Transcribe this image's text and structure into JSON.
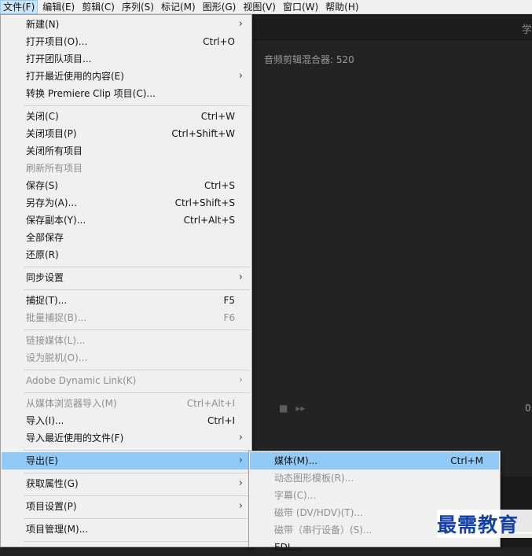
{
  "menubar": {
    "items": [
      "文件(F)",
      "编辑(E)",
      "剪辑(C)",
      "序列(S)",
      "标记(M)",
      "图形(G)",
      "视图(V)",
      "窗口(W)",
      "帮助(H)"
    ]
  },
  "background": {
    "panel_tab_fragment": "学",
    "audio_mixer_title": "音频剪辑混合器: 520",
    "timecode_fragment": "0"
  },
  "file_menu": {
    "new": {
      "label": "新建(N)"
    },
    "open_project": {
      "label": "打开项目(O)...",
      "shortcut": "Ctrl+O"
    },
    "open_team_project": {
      "label": "打开团队项目..."
    },
    "open_recent": {
      "label": "打开最近使用的内容(E)"
    },
    "convert_clip": {
      "label": "转换 Premiere Clip 项目(C)..."
    },
    "close": {
      "label": "关闭(C)",
      "shortcut": "Ctrl+W"
    },
    "close_project": {
      "label": "关闭项目(P)",
      "shortcut": "Ctrl+Shift+W"
    },
    "close_all_projects": {
      "label": "关闭所有项目"
    },
    "refresh_all_projects": {
      "label": "刷新所有项目"
    },
    "save": {
      "label": "保存(S)",
      "shortcut": "Ctrl+S"
    },
    "save_as": {
      "label": "另存为(A)...",
      "shortcut": "Ctrl+Shift+S"
    },
    "save_copy": {
      "label": "保存副本(Y)...",
      "shortcut": "Ctrl+Alt+S"
    },
    "save_all": {
      "label": "全部保存"
    },
    "revert": {
      "label": "还原(R)"
    },
    "sync_settings": {
      "label": "同步设置"
    },
    "capture": {
      "label": "捕捉(T)...",
      "shortcut": "F5"
    },
    "batch_capture": {
      "label": "批量捕捉(B)...",
      "shortcut": "F6"
    },
    "link_media": {
      "label": "链接媒体(L)..."
    },
    "make_offline": {
      "label": "设为脱机(O)..."
    },
    "dynamic_link": {
      "label": "Adobe Dynamic Link(K)"
    },
    "import_from_browser": {
      "label": "从媒体浏览器导入(M)",
      "shortcut": "Ctrl+Alt+I"
    },
    "import": {
      "label": "导入(I)...",
      "shortcut": "Ctrl+I"
    },
    "import_recent": {
      "label": "导入最近使用的文件(F)"
    },
    "export": {
      "label": "导出(E)"
    },
    "get_properties": {
      "label": "获取属性(G)"
    },
    "project_settings": {
      "label": "项目设置(P)"
    },
    "project_manager": {
      "label": "项目管理(M)..."
    }
  },
  "export_menu": {
    "media": {
      "label": "媒体(M)...",
      "shortcut": "Ctrl+M"
    },
    "motion_graphics_template": {
      "label": "动态图形模板(R)..."
    },
    "captions": {
      "label": "字幕(C)..."
    },
    "tape_dv_hdv": {
      "label": "磁带 (DV/HDV)(T)..."
    },
    "tape_serial": {
      "label": "磁带（串行设备）(S)..."
    },
    "edl": {
      "label": "EDL..."
    }
  },
  "watermark": {
    "text": "最需教育"
  },
  "colors": {
    "menu_bg": "#f0f0f0",
    "highlight": "#91c9f7",
    "disabled_text": "#8f8f8f",
    "app_bg": "#232323",
    "watermark": "#1540a8"
  }
}
